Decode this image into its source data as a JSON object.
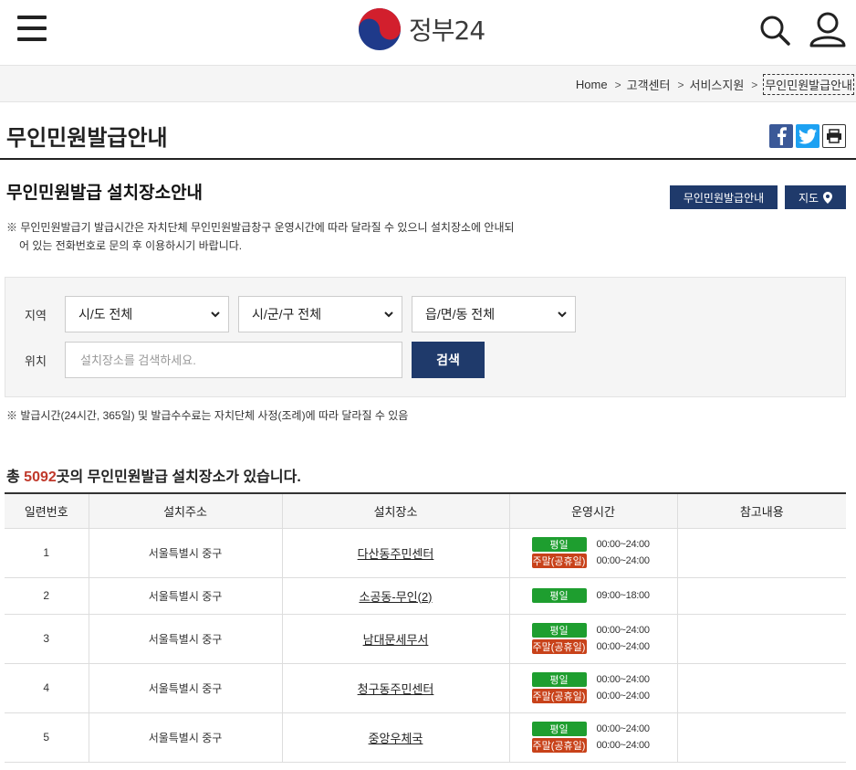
{
  "header": {
    "logo_text": "정부24"
  },
  "breadcrumb": {
    "items": [
      "Home",
      "고객센터",
      "서비스지원",
      "무인민원발급안내"
    ]
  },
  "page": {
    "title": "무인민원발급안내"
  },
  "section": {
    "title": "무인민원발급 설치장소안내",
    "info_button": "무인민원발급안내",
    "map_button": "지도",
    "note_line1": "※ 무인민원발급기 발급시간은 자치단체 무인민원발급창구 운영시간에 따라 달라질 수 있으니 설치장소에 안내되",
    "note_line2": "어 있는 전화번호로 문의 후 이용하시기 바랍니다."
  },
  "search": {
    "region_label": "지역",
    "sido": "시/도 전체",
    "sigungu": "시/군/구 전체",
    "eupmyeondong": "읍/면/동 전체",
    "location_label": "위치",
    "placeholder": "설치장소를 검색하세요.",
    "button": "검색"
  },
  "note2": "※ 발급시간(24시간, 365일) 및 발급수수료는 자치단체 사정(조례)에 따라 달라질 수 있음",
  "count": {
    "prefix": "총 ",
    "number": "5092",
    "suffix": "곳의 무인민원발급 설치장소가 있습니다."
  },
  "table": {
    "headers": [
      "일련번호",
      "설치주소",
      "설치장소",
      "운영시간",
      "참고내용"
    ],
    "badge_weekday": "평일",
    "badge_weekend": "주말(공휴일)",
    "rows": [
      {
        "no": "1",
        "addr": "서울특별시 중구",
        "place": "다산동주민센터",
        "weekday": "00:00~24:00",
        "weekend": "00:00~24:00"
      },
      {
        "no": "2",
        "addr": "서울특별시 중구",
        "place": "소공동-무인(2)",
        "weekday": "09:00~18:00"
      },
      {
        "no": "3",
        "addr": "서울특별시 중구",
        "place": "남대문세무서",
        "weekday": "00:00~24:00",
        "weekend": "00:00~24:00"
      },
      {
        "no": "4",
        "addr": "서울특별시 중구",
        "place": "청구동주민센터",
        "weekday": "00:00~24:00",
        "weekend": "00:00~24:00"
      },
      {
        "no": "5",
        "addr": "서울특별시 중구",
        "place": "중앙우체국",
        "weekday": "00:00~24:00",
        "weekend": "00:00~24:00"
      }
    ]
  }
}
